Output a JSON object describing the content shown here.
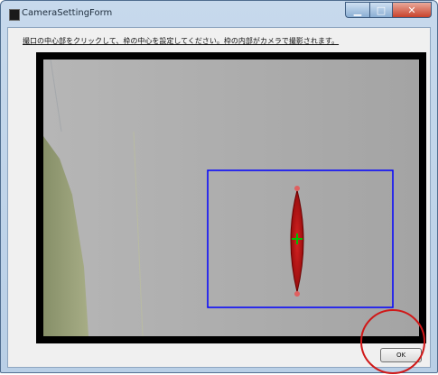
{
  "window": {
    "title": "CameraSettingForm"
  },
  "caption_buttons": {
    "minimize_icon": "minimize-icon",
    "maximize_icon": "maximize-icon",
    "close_icon": "close-icon"
  },
  "instruction_text": "撮口の中心部をクリックして、枠の中心を設定してください。枠の内部がカメラで撮影されます。",
  "camera": {
    "roi_color": "#0000ff",
    "marker_color": "#00c000",
    "object_color": "#cc1010"
  },
  "ok_button": {
    "label": "OK"
  },
  "annotation": {
    "color": "#d01818"
  }
}
